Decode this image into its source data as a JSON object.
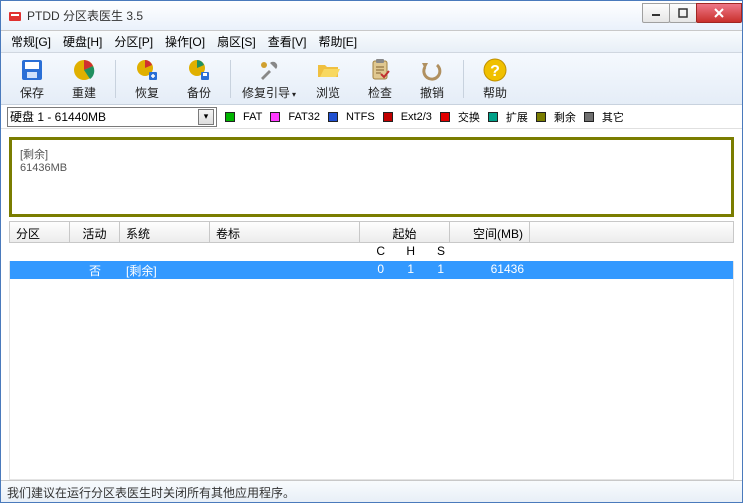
{
  "window": {
    "title": "PTDD 分区表医生 3.5"
  },
  "menu": {
    "general": "常规[G]",
    "disk": "硬盘[H]",
    "partition": "分区[P]",
    "operate": "操作[O]",
    "sector": "扇区[S]",
    "view": "查看[V]",
    "help": "帮助[E]"
  },
  "toolbar": {
    "save": "保存",
    "rebuild": "重建",
    "restore": "恢复",
    "backup": "备份",
    "fixboot": "修复引导",
    "browse": "浏览",
    "check": "检查",
    "undo": "撤销",
    "help": "帮助"
  },
  "disk": {
    "selected": "硬盘 1 - 61440MB"
  },
  "legend": {
    "fat": "FAT",
    "fat32": "FAT32",
    "ntfs": "NTFS",
    "ext": "Ext2/3",
    "swap": "交换",
    "extended": "扩展",
    "free": "剩余",
    "other": "其它"
  },
  "colors": {
    "fat": "#00b400",
    "fat32": "#ff3cff",
    "ntfs": "#2050d0",
    "ext": "#c00000",
    "swap": "#e00000",
    "extended": "#00a088",
    "free": "#7a7d00",
    "other": "#707070"
  },
  "diskmap": {
    "label": "[剩余]",
    "size": "61436MB"
  },
  "headers": {
    "partition": "分区",
    "active": "活动",
    "system": "系统",
    "label": "卷标",
    "start": "起始",
    "space": "空间(MB)",
    "c": "C",
    "h": "H",
    "s": "S"
  },
  "rows": [
    {
      "partition": "",
      "active": "否",
      "system": "[剩余]",
      "label": "",
      "c": "0",
      "h": "1",
      "s": "1",
      "space": "61436"
    }
  ],
  "status": "我们建议在运行分区表医生时关闭所有其他应用程序。"
}
